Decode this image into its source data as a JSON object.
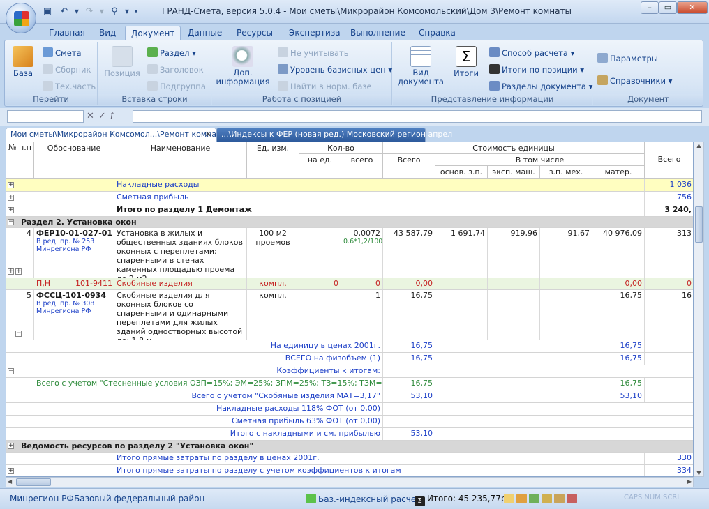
{
  "window": {
    "title": "ГРАНД-Смета, версия 5.0.4 - Мои сметы\\Микрорайон Комсомольский\\Дом 3\\Ремонт комнаты"
  },
  "ribbon_tabs": [
    "Главная",
    "Вид",
    "Документ",
    "Данные",
    "Ресурсы",
    "Экспертиза",
    "Выполнение",
    "Справка"
  ],
  "ribbon": {
    "go": {
      "base": "База",
      "smeta": "Смета",
      "sbornik": "Сборник",
      "techpart": "Тех.часть",
      "label": "Перейти"
    },
    "insert": {
      "position": "Позиция",
      "section": "Раздел",
      "header": "Заголовок",
      "subgroup": "Подгруппа",
      "label": "Вставка строки"
    },
    "work": {
      "extra_info": "Доп. информация",
      "ignore": "Не учитывать",
      "base_level": "Уровень базисных цен",
      "find": "Найти в норм. базе",
      "label": "Работа с позицией"
    },
    "view": {
      "doc_view": "Вид документа",
      "totals": "Итоги",
      "calc_method": "Способ расчета",
      "totals_pos": "Итоги по позиции",
      "sections": "Разделы документа",
      "label": "Представление информации"
    },
    "doc": {
      "params": "Параметры",
      "refs": "Справочники",
      "label": "Документ"
    }
  },
  "doc_tabs": {
    "tab1": "Мои сметы\\Микрорайон Комсомол...\\Ремонт комнаты",
    "tab2": "...\\Индексы к ФЕР (новая ред.) Московский регион апрел"
  },
  "headers": {
    "num": "№ п.п",
    "basis": "Обоснование",
    "name": "Наименование",
    "unit": "Ед. изм.",
    "qty": "Кол-во",
    "qty_per": "на ед.",
    "qty_total": "всего",
    "cost": "Стоимость единицы",
    "cost_total": "Всего",
    "incl": "В том числе",
    "osn": "основ. з.п.",
    "eksp": "эксп. маш.",
    "zpmeh": "з.п. мех.",
    "mater": "матер.",
    "grand": "Всего"
  },
  "rows": {
    "overhead": {
      "name": "Накладные расходы",
      "val": "1 036"
    },
    "profit": {
      "name": "Сметная прибыль",
      "val": "756"
    },
    "sec1_total": {
      "name": "Итого по разделу 1 Демонтаж",
      "val": "3 240,"
    },
    "sec2": {
      "name": "Раздел 2. Установка окон"
    },
    "pos4": {
      "num": "4",
      "code": "ФЕР10-01-027-01",
      "ed": "В ред. пр. № 253",
      "org": "Минрегиона РФ",
      "name": "Установка в жилых и общественных зданиях блоков оконных с переплетами: спаренными в стенах каменных площадью проема до 2 м2",
      "unit": "100 м2 проемов",
      "qty": "0,0072",
      "formula": "0.6*1,2/100",
      "total": "43 587,79",
      "osn": "1 691,74",
      "eksp": "919,96",
      "zp": "91,67",
      "mat": "40 976,09",
      "grand": "313"
    },
    "pn": {
      "code": "П,Н",
      "num": "101-9411",
      "name": "Скобяные изделия",
      "unit": "компл.",
      "qty_per": "0",
      "qty": "0",
      "total": "0,00",
      "mat": "0,00",
      "grand": "0"
    },
    "pos5": {
      "num": "5",
      "code": "ФССЦ-101-0934",
      "ed": "В ред. пр. № 308",
      "org": "Минрегиона РФ",
      "name": "Скобяные изделия для оконных блоков со спаренными и одинарными переплетами для жилых зданий одностворных высотой до: 1,8 м",
      "unit": "компл.",
      "qty": "1",
      "total": "16,75",
      "mat": "16,75",
      "grand": "16"
    },
    "per_unit": {
      "label": "На единицу в ценах 2001г.",
      "total": "16,75",
      "mat": "16,75"
    },
    "all_phys": {
      "label": "ВСЕГО на физобъем (1)",
      "total": "16,75",
      "mat": "16,75"
    },
    "coefs": {
      "label": "Коэффициенты к итогам:"
    },
    "coef1": {
      "label": "Всего с учетом \"Стесненные условия ОЗП=15%; ЭМ=25%; ЗПМ=25%; ТЗ=15%; ТЗМ=25%\"",
      "total": "16,75",
      "mat": "16,75"
    },
    "coef2": {
      "label": "Всего с учетом \"Скобяные изделия МАТ=3,17\"",
      "total": "53,10",
      "mat": "53,10"
    },
    "nr": {
      "label": "Накладные расходы 118% ФОТ (от 0,00)"
    },
    "sp": {
      "label": "Сметная прибыль 63% ФОТ (от 0,00)"
    },
    "with_nr": {
      "label": "Итого с накладными и см. прибылью",
      "total": "53,10"
    },
    "vedom": {
      "name": "Ведомость ресурсов по разделу 2 \"Установка окон\""
    },
    "direct": {
      "name": "Итого прямые затраты по разделу в ценах 2001г.",
      "val": "330"
    },
    "direct_coef": {
      "name": "Итого прямые затраты по разделу с учетом коэффициентов к итогам",
      "val": "334"
    }
  },
  "status": {
    "region": "Минрегион РФ",
    "district": "Базовый федеральный район",
    "method": "Баз.-индексный расчет",
    "total": "Итого: 45 235,77р.",
    "keys": "CAPS  NUM  SCRL"
  },
  "colors": {
    "accent": "#15428b",
    "highlight_row": "#fffec0",
    "section_row": "#d7d7d7",
    "resource_row": "#eaf5e0"
  }
}
